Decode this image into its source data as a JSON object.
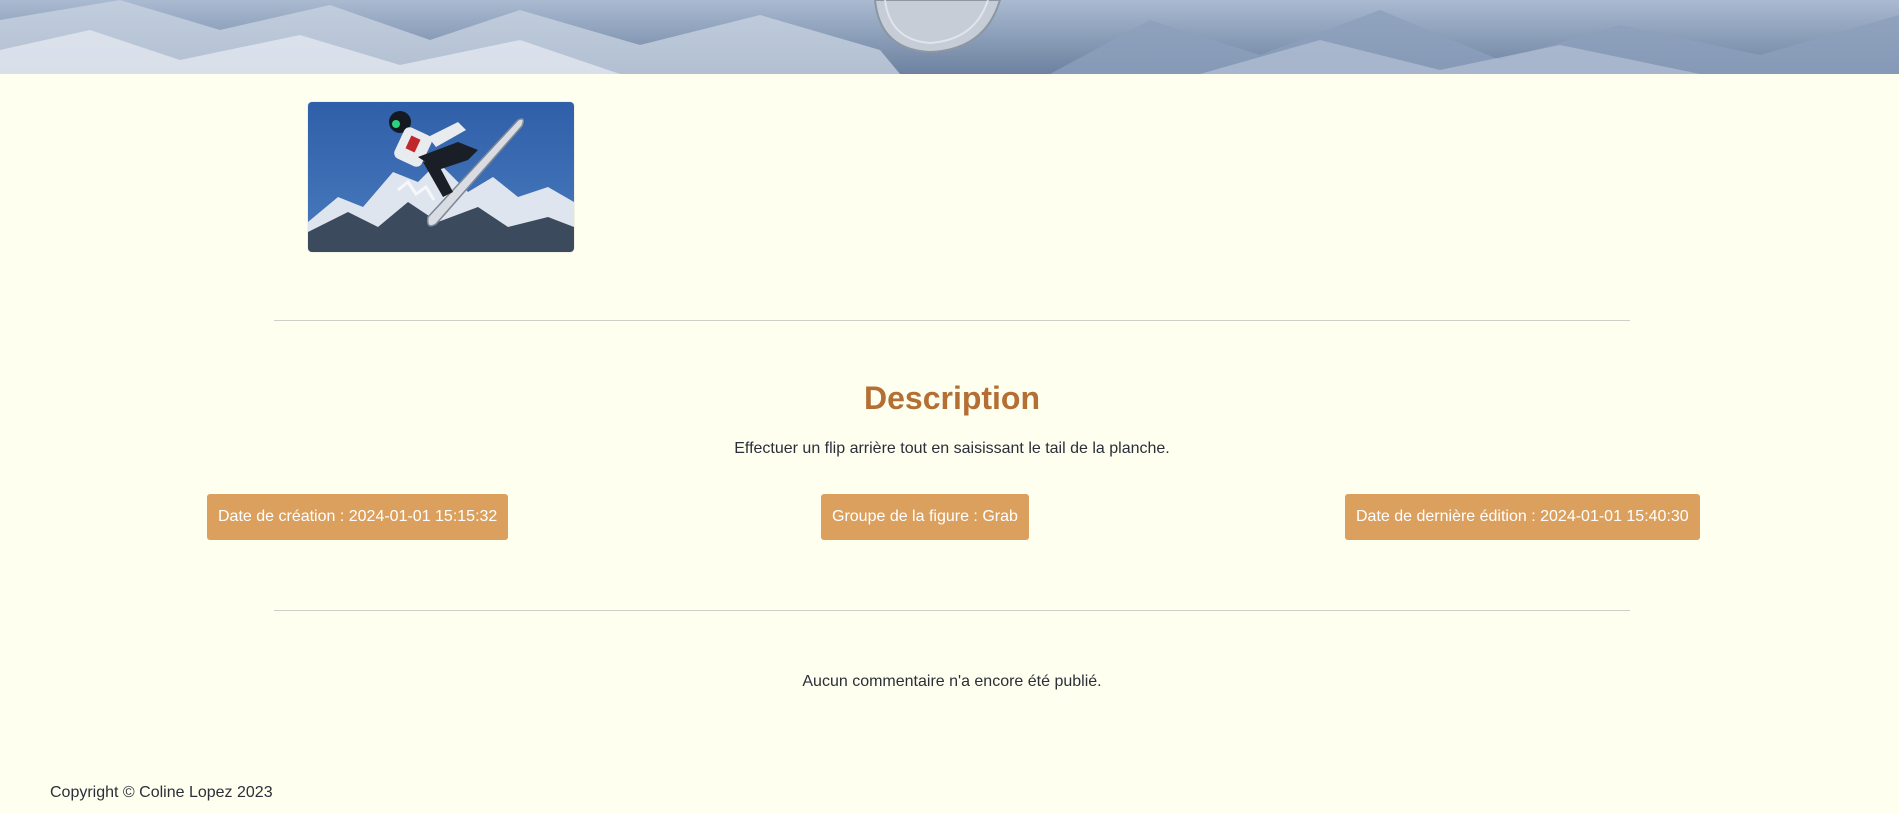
{
  "hero": {
    "image": "snowboard-mountain-banner"
  },
  "thumbnail": {
    "image": "snowboarder-trick-photo"
  },
  "description": {
    "title": "Description",
    "text": "Effectuer un flip arrière tout en saisissant le tail de la planche."
  },
  "meta": {
    "created": "Date de création : 2024-01-01 15:15:32",
    "group": "Groupe de la figure : Grab",
    "edited": "Date de dernière édition : 2024-01-01 15:40:30"
  },
  "comments": {
    "empty_message": "Aucun commentaire n'a encore été publié."
  },
  "footer": {
    "copyright": "Copyright © Coline Lopez 2023"
  },
  "colors": {
    "background": "#fffff0",
    "accent_title": "#b46f34",
    "badge_bg": "#dba05e",
    "badge_text": "#ffffff"
  }
}
